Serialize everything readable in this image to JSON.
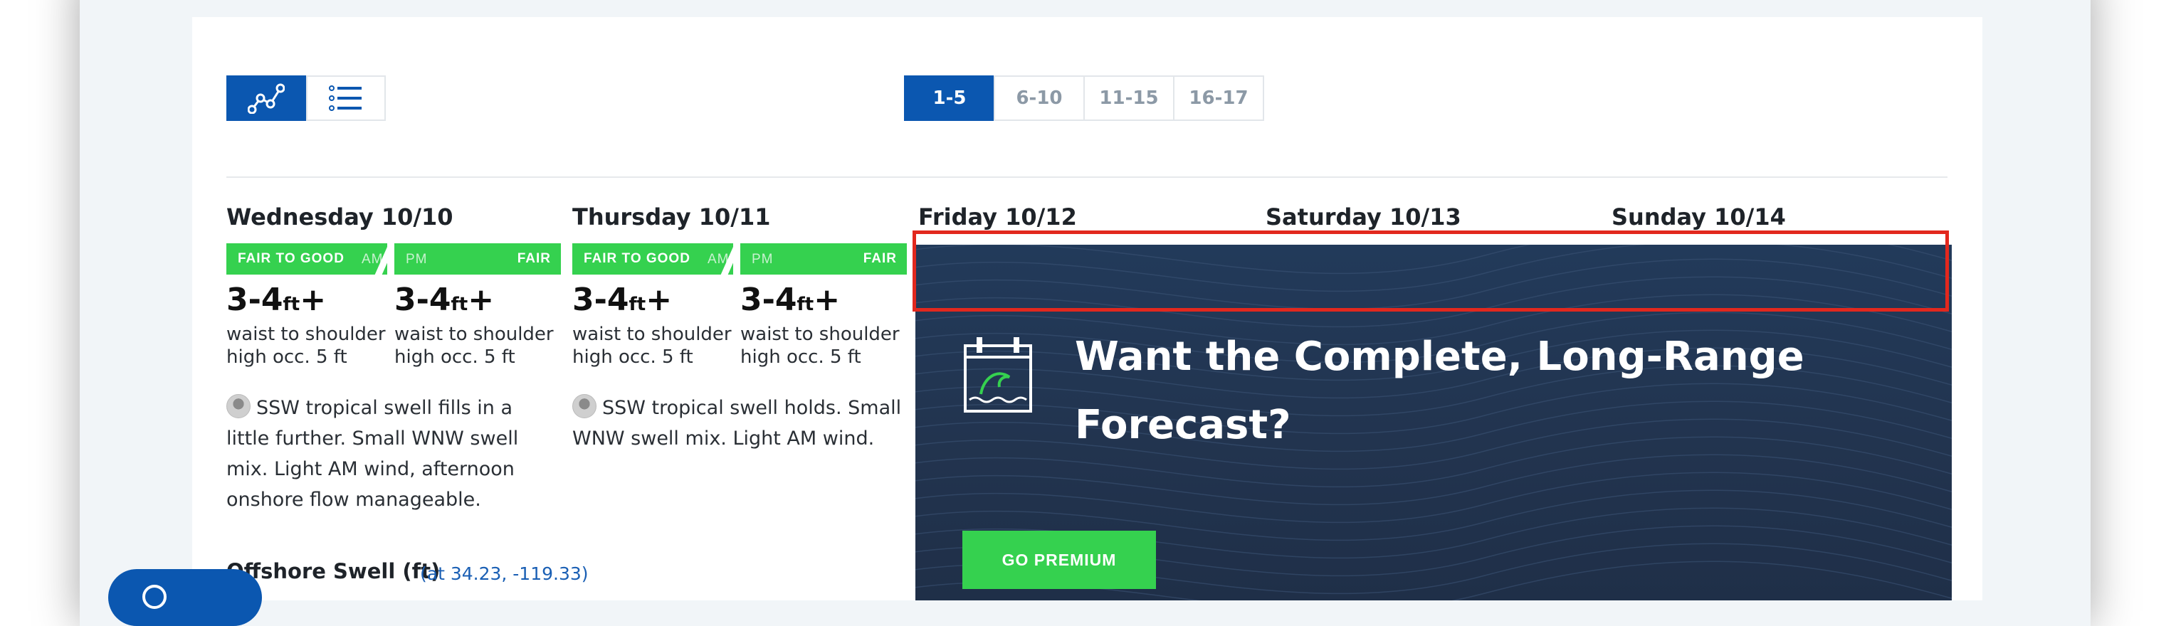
{
  "view_toggle": {
    "chart_view": {
      "icon": "line-chart-icon"
    },
    "list_view": {
      "icon": "list-icon"
    }
  },
  "range_tabs": [
    "1-5",
    "6-10",
    "11-15",
    "16-17"
  ],
  "active_range": "1-5",
  "days": [
    {
      "title": "Wednesday 10/10",
      "rating_am": "FAIR TO GOOD",
      "am_label": "AM",
      "pm_label": "PM",
      "rating_pm": "FAIR",
      "am_height": "3-4",
      "pm_height": "3-4",
      "unit": "ft",
      "plus": "+",
      "am_desc1": "waist to shoulder",
      "am_desc2": "high occ. 5 ft",
      "pm_desc1": "waist to shoulder",
      "pm_desc2": "high occ. 5 ft",
      "summary": "SSW tropical swell fills in a little further. Small WNW swell mix. Light AM wind, afternoon onshore flow manageable."
    },
    {
      "title": "Thursday 10/11",
      "rating_am": "FAIR TO GOOD",
      "am_label": "AM",
      "pm_label": "PM",
      "rating_pm": "FAIR",
      "am_height": "3-4",
      "pm_height": "3-4",
      "unit": "ft",
      "plus": "+",
      "am_desc1": "waist to shoulder",
      "am_desc2": "high occ. 5 ft",
      "pm_desc1": "waist to shoulder",
      "pm_desc2": "high occ. 5 ft",
      "summary": "SSW tropical swell holds. Small WNW swell mix. Light AM wind."
    }
  ],
  "locked_days": [
    "Friday 10/12",
    "Saturday 10/13",
    "Sunday 10/14"
  ],
  "premium": {
    "title": "Want the Complete, Long-Range Forecast?",
    "button": "GO PREMIUM",
    "icon": "calendar-wave-icon"
  },
  "offshore": {
    "label": "Offshore Swell (ft)",
    "coords": "(at 34.23, -119.33)"
  },
  "colors": {
    "brand_blue": "#0b57b0",
    "rating_green": "#35d14f",
    "premium_bg": "#22344f",
    "highlight": "#e2281e"
  }
}
